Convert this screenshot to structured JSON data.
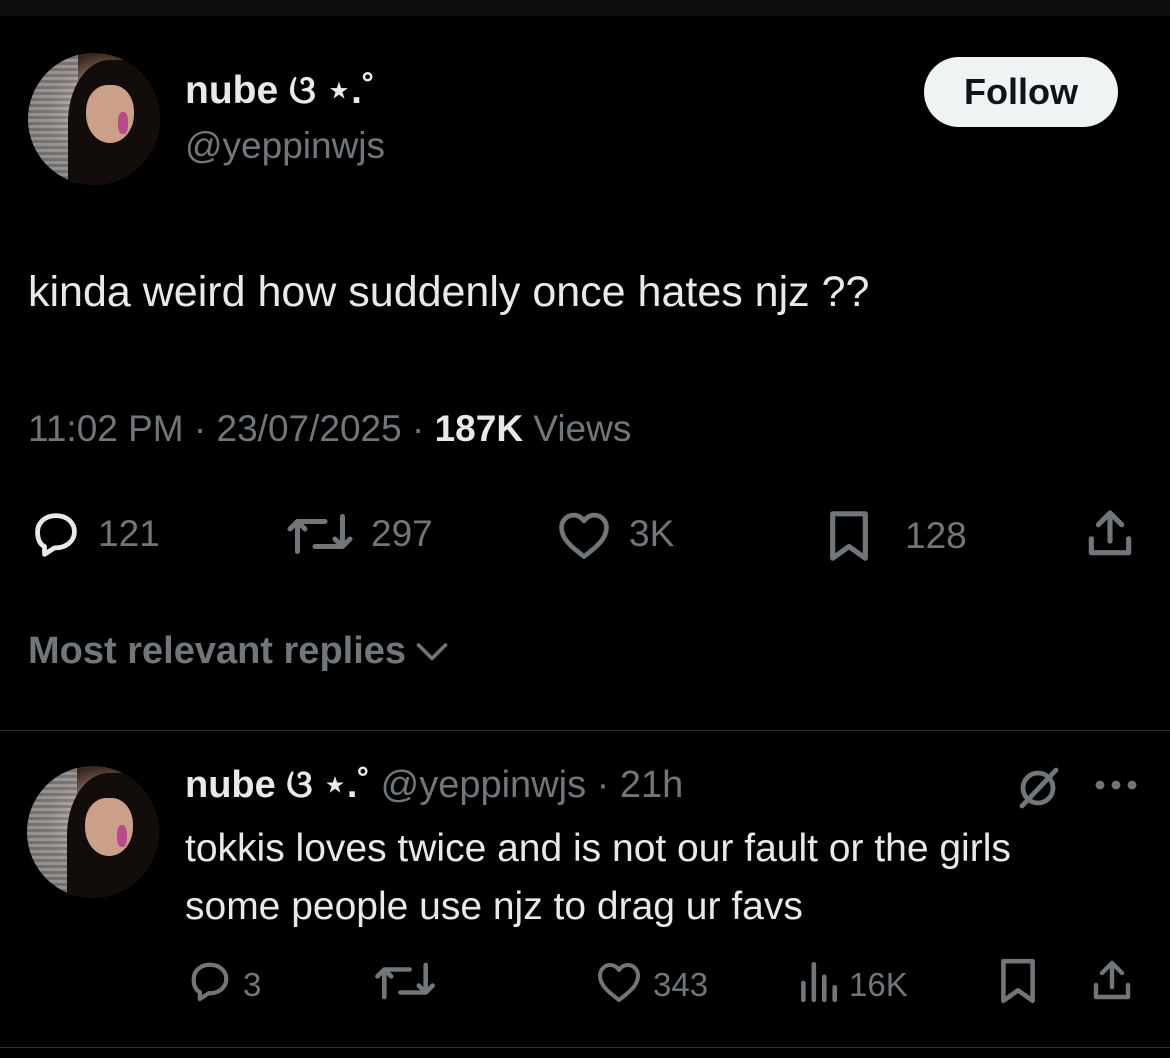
{
  "tweet": {
    "display_name": "nube ଓ ⋆.˚",
    "handle": "@yeppinwjs",
    "follow_label": "Follow",
    "text": "kinda weird how suddenly once hates njz ??",
    "time": "11:02 PM",
    "date": "23/07/2025",
    "views_count": "187K",
    "views_label": "Views",
    "replies": "121",
    "reposts": "297",
    "likes": "3K",
    "bookmarks": "128"
  },
  "replies_sort": {
    "label": "Most relevant replies"
  },
  "reply": {
    "display_name": "nube ଓ ⋆.˚",
    "handle": "@yeppinwjs",
    "age": "21h",
    "text": "tokkis loves twice and is not our fault or the girls some people use njz to drag ur favs",
    "replies": "3",
    "likes": "343",
    "views": "16K"
  },
  "colors": {
    "background": "#000000",
    "text_primary": "#e7e9ea",
    "text_secondary": "#71767b",
    "follow_bg": "#eff3f4",
    "divider": "#2f3336"
  },
  "icons": [
    "reply-icon",
    "repost-icon",
    "like-icon",
    "bookmark-icon",
    "share-icon",
    "chevron-down-icon",
    "grok-icon",
    "more-icon",
    "views-icon"
  ]
}
